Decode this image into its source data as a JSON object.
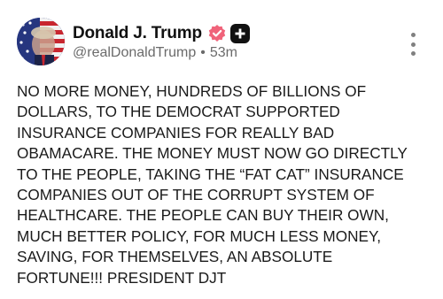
{
  "author": {
    "display_name": "Donald J. Trump",
    "handle": "@realDonaldTrump",
    "separator": "•",
    "time_ago": "53m",
    "avatar_icon": "profile-photo-flag-avatar",
    "verified_icon": "verified-check-icon",
    "verified_color": "#f0637a",
    "badge_icon": "plus-badge-icon"
  },
  "menu": {
    "icon": "more-vertical-icon"
  },
  "post": {
    "lines": [
      "NO MORE MONEY, HUNDREDS OF BILLIONS OF",
      "DOLLARS, TO THE DEMOCRAT SUPPORTED",
      "INSURANCE COMPANIES FOR REALLY BAD",
      "OBAMACARE. THE MONEY MUST NOW GO DIRECTLY",
      "TO THE PEOPLE, TAKING THE “FAT CAT” INSURANCE",
      "COMPANIES OUT OF THE CORRUPT SYSTEM OF",
      "HEALTHCARE. THE PEOPLE CAN BUY THEIR OWN,",
      "MUCH BETTER POLICY, FOR MUCH LESS MONEY,",
      "SAVING, FOR THEMSELVES, AN ABSOLUTE",
      "FORTUNE!!! PRESIDENT DJT"
    ]
  }
}
